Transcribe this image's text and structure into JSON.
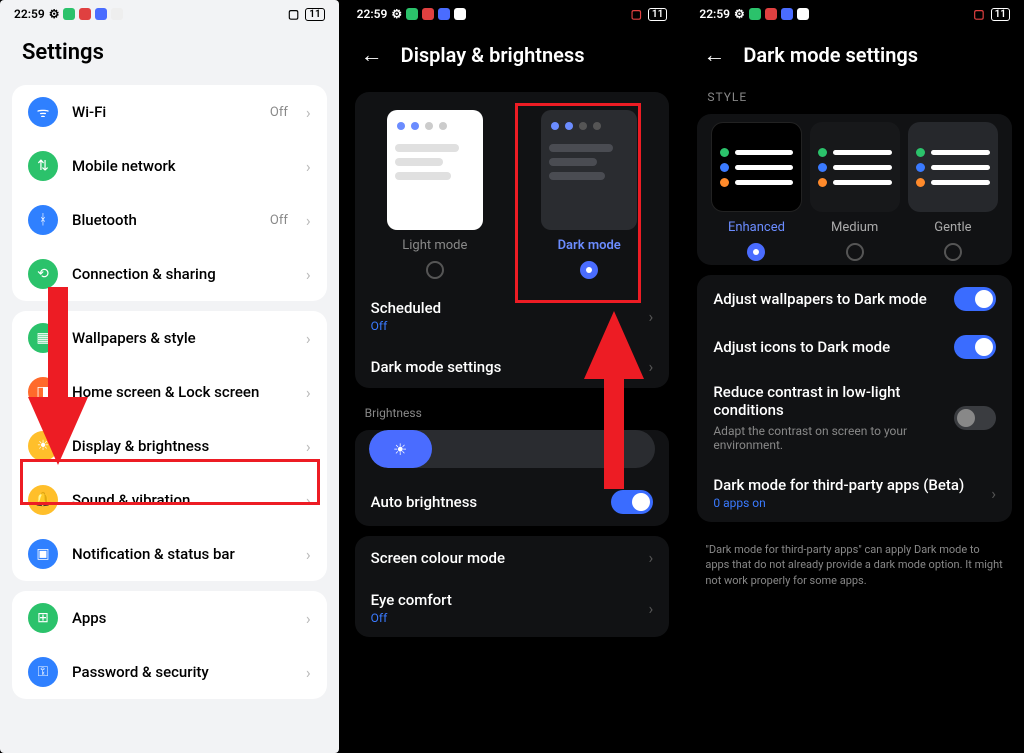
{
  "status": {
    "time": "22:59",
    "battery": "11"
  },
  "panel1": {
    "title": "Settings",
    "groups": [
      [
        {
          "icon": "wifi",
          "color": "#2f80ff",
          "label": "Wi-Fi",
          "value": "Off"
        },
        {
          "icon": "swap",
          "color": "#2bc26b",
          "label": "Mobile network"
        },
        {
          "icon": "bt",
          "color": "#2f80ff",
          "label": "Bluetooth",
          "value": "Off"
        },
        {
          "icon": "link",
          "color": "#2bc26b",
          "label": "Connection & sharing"
        }
      ],
      [
        {
          "icon": "wall",
          "color": "#2bc26b",
          "label": "Wallpapers & style"
        },
        {
          "icon": "home",
          "color": "#ff6a2b",
          "label": "Home screen & Lock screen"
        },
        {
          "icon": "sun",
          "color": "#ffbf2b",
          "label": "Display & brightness",
          "highlight": true
        },
        {
          "icon": "bell",
          "color": "#ffbf2b",
          "label": "Sound & vibration"
        },
        {
          "icon": "notif",
          "color": "#2f80ff",
          "label": "Notification & status bar"
        }
      ],
      [
        {
          "icon": "apps",
          "color": "#2bc26b",
          "label": "Apps"
        },
        {
          "icon": "key",
          "color": "#2f80ff",
          "label": "Password & security"
        }
      ]
    ]
  },
  "panel2": {
    "title": "Display & brightness",
    "modes": {
      "light": "Light mode",
      "dark": "Dark mode",
      "selected": "dark"
    },
    "scheduled": {
      "label": "Scheduled",
      "value": "Off"
    },
    "dms": "Dark mode settings",
    "brightness_section": "Brightness",
    "auto_brightness": {
      "label": "Auto brightness",
      "on": true
    },
    "screen_colour": "Screen colour mode",
    "eye_comfort": {
      "label": "Eye comfort",
      "value": "Off"
    }
  },
  "panel3": {
    "title": "Dark mode settings",
    "section_style": "STYLE",
    "styles": {
      "enhanced": "Enhanced",
      "medium": "Medium",
      "gentle": "Gentle",
      "selected": "enhanced"
    },
    "adjust_wall": {
      "label": "Adjust wallpapers to Dark mode",
      "on": true
    },
    "adjust_icons": {
      "label": "Adjust icons to Dark mode",
      "on": true
    },
    "reduce_contrast": {
      "label": "Reduce contrast in low-light conditions",
      "sub": "Adapt the contrast on screen to your environment.",
      "on": false
    },
    "third_party": {
      "label": "Dark mode for third-party apps (Beta)",
      "sub": "0 apps on"
    },
    "helper": "\"Dark mode for third-party apps\" can apply Dark mode to apps that do not already provide a dark mode option. It might not work properly for some apps."
  }
}
